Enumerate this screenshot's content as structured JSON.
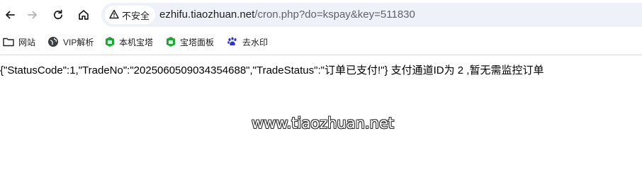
{
  "browser": {
    "security_label": "不安全",
    "url_host": "ezhifu.tiaozhuan.net",
    "url_rest": "/cron.php?do=kspay&key=511830"
  },
  "bookmarks": [
    {
      "label": "网站",
      "icon": "folder-icon"
    },
    {
      "label": "VIP解析",
      "icon": "globe-icon"
    },
    {
      "label": "本机宝塔",
      "icon": "bt-panel-icon"
    },
    {
      "label": "宝塔面板",
      "icon": "bt-panel-icon"
    },
    {
      "label": "去水印",
      "icon": "paw-icon"
    }
  ],
  "page": {
    "response_text": "{\"StatusCode\":1,\"TradeNo\":\"2025060509034354688\",\"TradeStatus\":\"订单已支付!\"} 支付通道ID为 2 ,暂无需监控订单",
    "watermark": "www.tiaozhuan.net"
  },
  "colors": {
    "omnibox_bg": "#eef1f8",
    "bt_green": "#20a53a",
    "paw_blue": "#2932e1"
  }
}
